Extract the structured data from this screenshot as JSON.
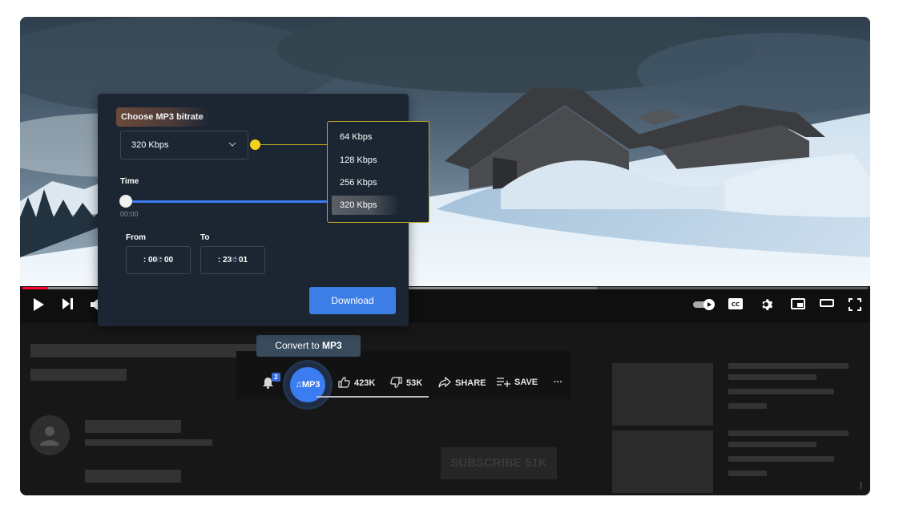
{
  "panel": {
    "title": "Choose MP3 bitrate",
    "selected_bitrate": "320 Kbps",
    "time_label": "Time",
    "current_time": "00:00",
    "from_label": "From",
    "to_label": "To",
    "from_dim": "00",
    "from_value": ": 00 : 00",
    "to_dim": "00",
    "to_value": ": 23 : 01",
    "download_label": "Download"
  },
  "bitrate_options": [
    "64 Kbps",
    "128 Kbps",
    "256 Kbps",
    "320 Kbps"
  ],
  "tooltip": {
    "text": "Convert to ",
    "bold": "MP3"
  },
  "actions": {
    "notification_count": "2",
    "mp3_button": "MP3",
    "likes": "423K",
    "dislikes": "53K",
    "share": "SHARE",
    "save": "SAVE",
    "more": "···"
  },
  "page": {
    "subscribe_label": "SUBSCRIBE 51K"
  },
  "colors": {
    "accent": "#3b7cf0",
    "panel_bg": "#1c2633",
    "knob": "#f5d21b",
    "progress": "#ff0033"
  }
}
